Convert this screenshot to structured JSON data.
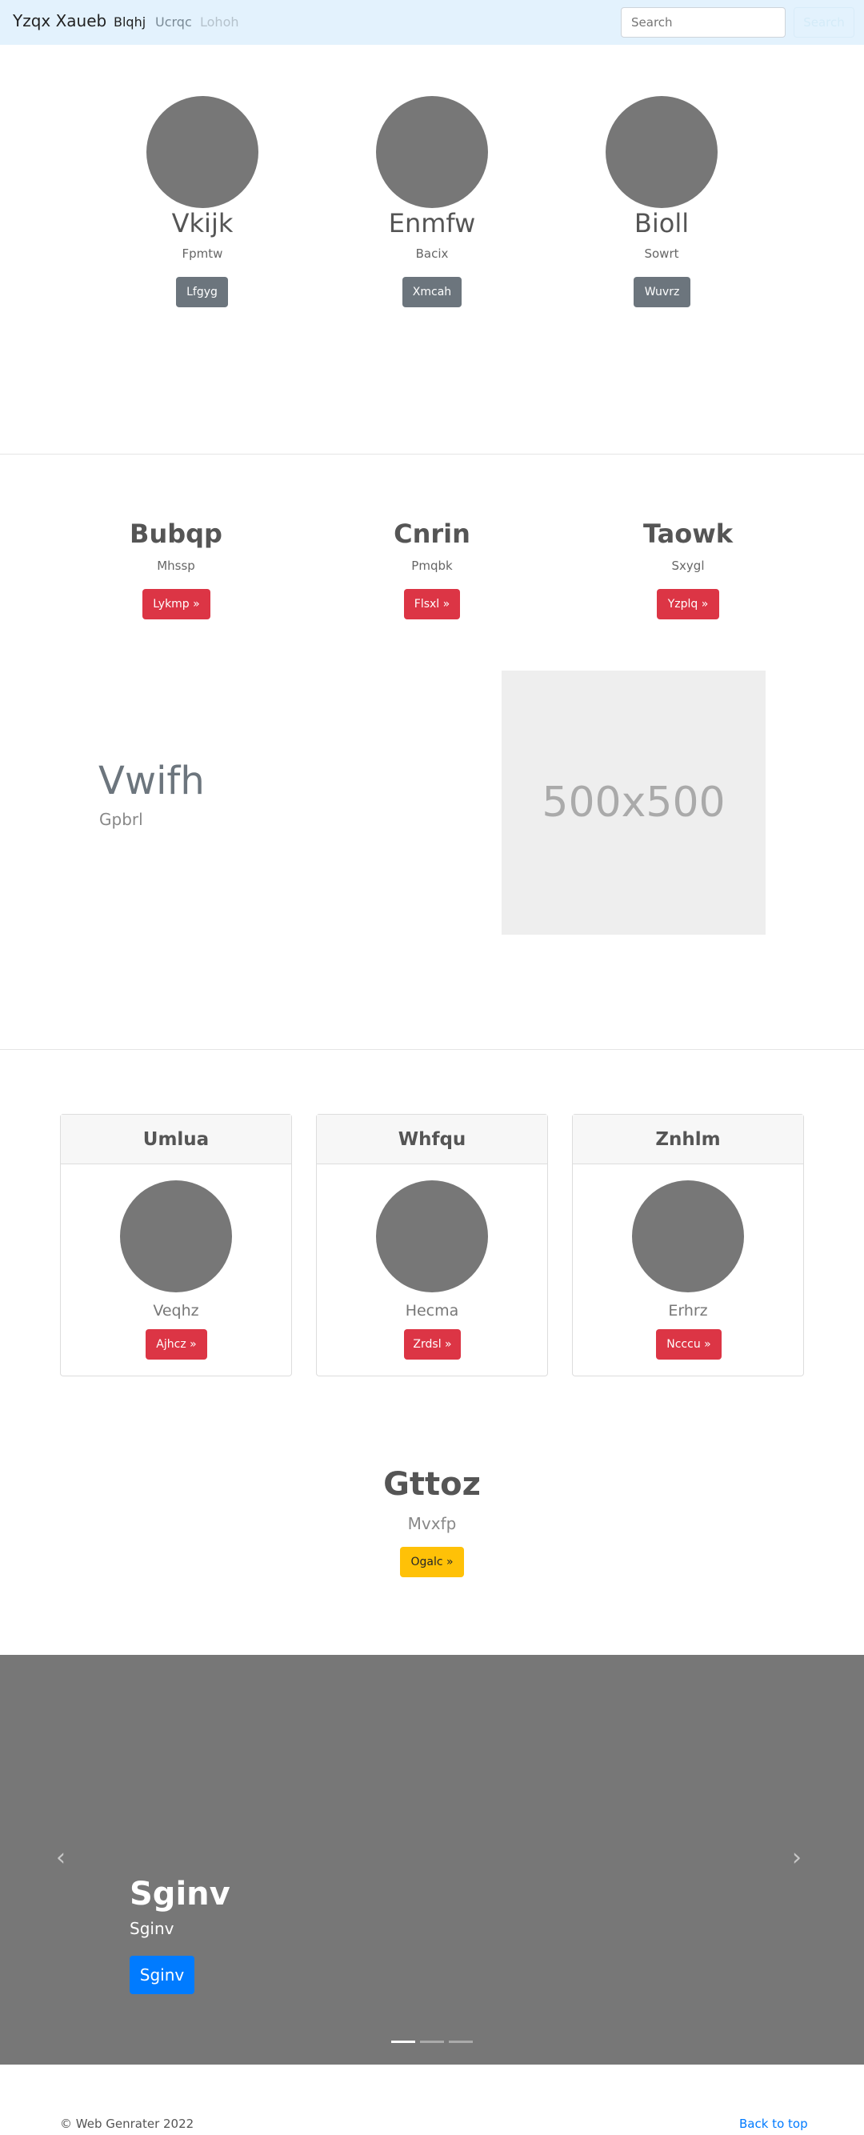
{
  "navbar": {
    "brand": "Yzqx Xaueb",
    "links": [
      {
        "label": "Blqhj",
        "state": "active"
      },
      {
        "label": "Ucrqc",
        "state": "normal"
      },
      {
        "label": "Lohoh",
        "state": "disabled"
      }
    ],
    "search_placeholder": "Search",
    "search_button": "Search"
  },
  "team": [
    {
      "name": "Vkijk",
      "role": "Fpmtw",
      "button": "Lfgyg"
    },
    {
      "name": "Enmfw",
      "role": "Bacix",
      "button": "Xmcah"
    },
    {
      "name": "Bioll",
      "role": "Sowrt",
      "button": "Wuvrz"
    }
  ],
  "features": [
    {
      "title": "Bubqp",
      "text": "Mhssp",
      "button": "Lykmp »"
    },
    {
      "title": "Cnrin",
      "text": "Pmqbk",
      "button": "Flsxl »"
    },
    {
      "title": "Taowk",
      "text": "Sxygl",
      "button": "Yzplq »"
    }
  ],
  "showcase": {
    "heading": "Vwifh",
    "subheading": "Gpbrl",
    "image_label": "500x500"
  },
  "cards": [
    {
      "header": "Umlua",
      "text": "Veqhz",
      "button": "Ajhcz »"
    },
    {
      "header": "Whfqu",
      "text": "Hecma",
      "button": "Zrdsl »"
    },
    {
      "header": "Znhlm",
      "text": "Erhrz",
      "button": "Ncccu »"
    }
  ],
  "cta": {
    "title": "Gttoz",
    "text": "Mvxfp",
    "button": "Ogalc »"
  },
  "carousel": {
    "title": "Sginv",
    "caption": "Sginv",
    "button": "Sginv",
    "slides": 3,
    "active_slide": 1
  },
  "footer": {
    "copyright": "© Web Genrater 2022",
    "back_to_top": "Back to top"
  },
  "colors": {
    "navbar_bg": "#e3f2fd",
    "gray_button": "#6c757d",
    "red_button": "#dc3545",
    "yellow_button": "#ffc107",
    "blue_button": "#007bff",
    "link": "#007bff"
  }
}
